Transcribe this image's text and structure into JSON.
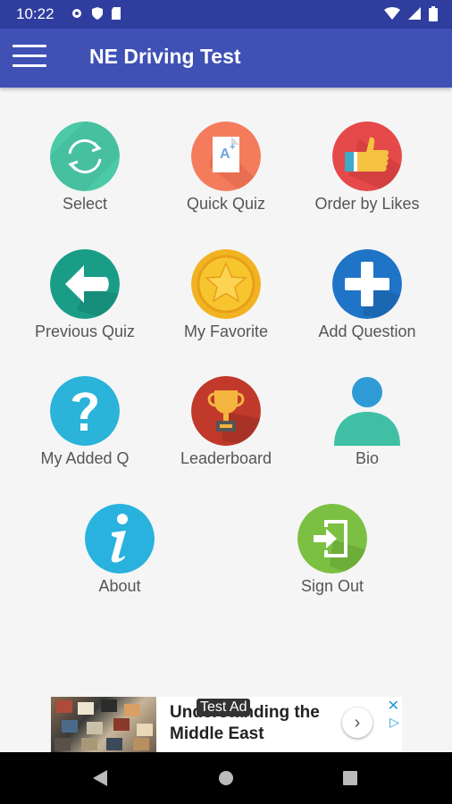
{
  "status_bar": {
    "time": "10:22"
  },
  "app_bar": {
    "title": "NE Driving Test"
  },
  "menu": [
    {
      "name": "select",
      "label": "Select",
      "icon": "refresh-icon"
    },
    {
      "name": "quick-quiz",
      "label": "Quick Quiz",
      "icon": "grade-document-icon"
    },
    {
      "name": "order-by-likes",
      "label": "Order by Likes",
      "icon": "thumbs-up-icon"
    },
    {
      "name": "previous-quiz",
      "label": "Previous Quiz",
      "icon": "arrow-left-icon"
    },
    {
      "name": "my-favorite",
      "label": "My Favorite",
      "icon": "star-icon"
    },
    {
      "name": "add-question",
      "label": "Add Question",
      "icon": "plus-icon"
    },
    {
      "name": "my-added-q",
      "label": "My Added Q",
      "icon": "question-mark-icon"
    },
    {
      "name": "leaderboard",
      "label": "Leaderboard",
      "icon": "trophy-icon"
    },
    {
      "name": "bio",
      "label": "Bio",
      "icon": "person-icon"
    },
    {
      "name": "about",
      "label": "About",
      "icon": "info-icon"
    },
    {
      "name": "sign-out",
      "label": "Sign Out",
      "icon": "sign-out-icon"
    }
  ],
  "ad": {
    "headline": "Understanding the Middle East",
    "badge": "Test Ad"
  },
  "colors": {
    "status_bar": "#2f3e9e",
    "app_bar": "#3f51b5",
    "background": "#f5f5f5"
  }
}
